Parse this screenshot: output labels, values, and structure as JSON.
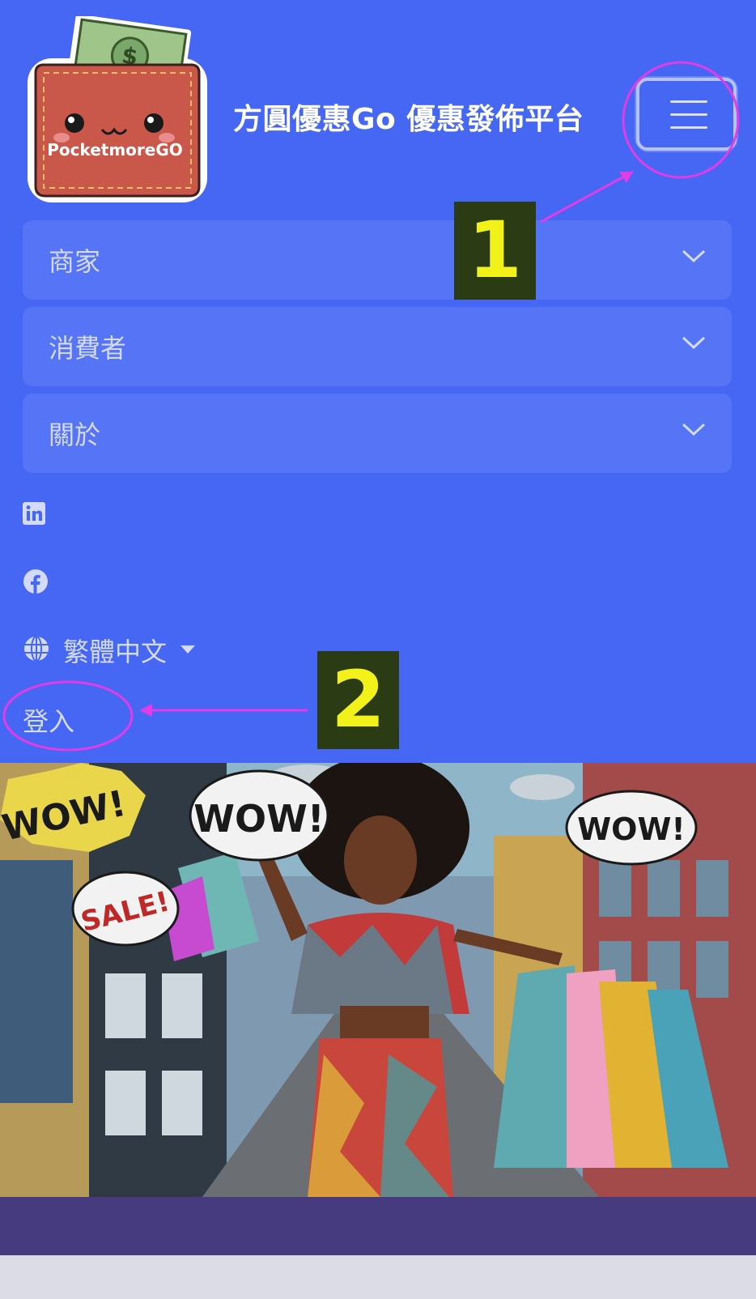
{
  "brand": {
    "title": "方圓優惠Go 優惠發佈平台",
    "logo_text": "PocketmoreGO",
    "logo_icon": "wallet-logo"
  },
  "nav": {
    "toggle_icon": "hamburger-menu-icon",
    "items": [
      {
        "label": "商家"
      },
      {
        "label": "消費者"
      },
      {
        "label": "關於"
      }
    ],
    "social": [
      {
        "icon": "linkedin-icon"
      },
      {
        "icon": "facebook-icon"
      }
    ],
    "language": {
      "label": "繁體中文",
      "icon": "globe-icon"
    },
    "login": "登入"
  },
  "hero": {
    "bubble_texts": [
      "WOW!",
      "WOW!",
      "WOW!",
      "SALE!"
    ]
  },
  "annotations": [
    {
      "number": "1"
    },
    {
      "number": "2"
    }
  ],
  "colors": {
    "header_bg": "#4666f4",
    "accordion_bg": "#5674f6",
    "annotation_bg": "#2b3b14",
    "annotation_fg": "#f2f21a",
    "annotation_line": "#e33be6"
  }
}
